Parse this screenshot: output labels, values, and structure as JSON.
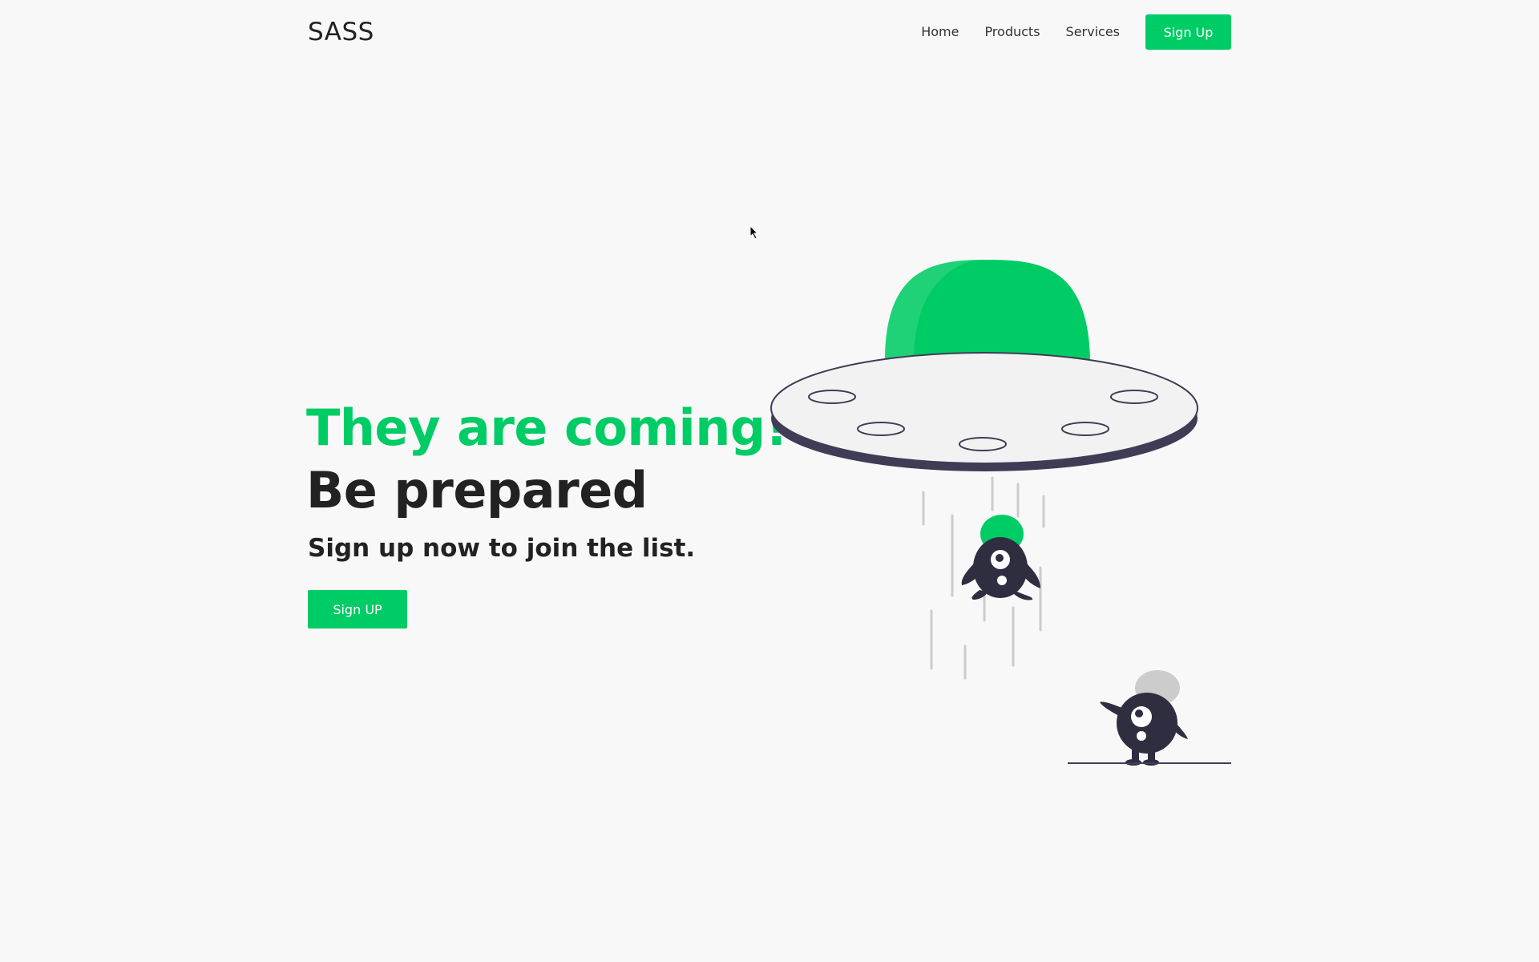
{
  "brand": {
    "logo_text": "SASS"
  },
  "nav": {
    "items": [
      {
        "label": "Home"
      },
      {
        "label": "Products"
      },
      {
        "label": "Services"
      }
    ],
    "cta_label": "Sign Up"
  },
  "hero": {
    "title_line1": "They are coming!",
    "title_line2": "Be prepared",
    "subtitle": "Sign up now to join the list.",
    "cta_label": "Sign UP"
  },
  "illustration": {
    "name": "ufo-abduction-illustration",
    "icons": [
      "ufo-icon",
      "falling-alien-icon",
      "standing-alien-icon"
    ]
  },
  "colors": {
    "accent": "#00cc66",
    "text": "#222222",
    "background": "#f8f8f8",
    "ufo_dark": "#3f3d56",
    "alien_body": "#2f2e41",
    "beam": "#cccccc"
  }
}
